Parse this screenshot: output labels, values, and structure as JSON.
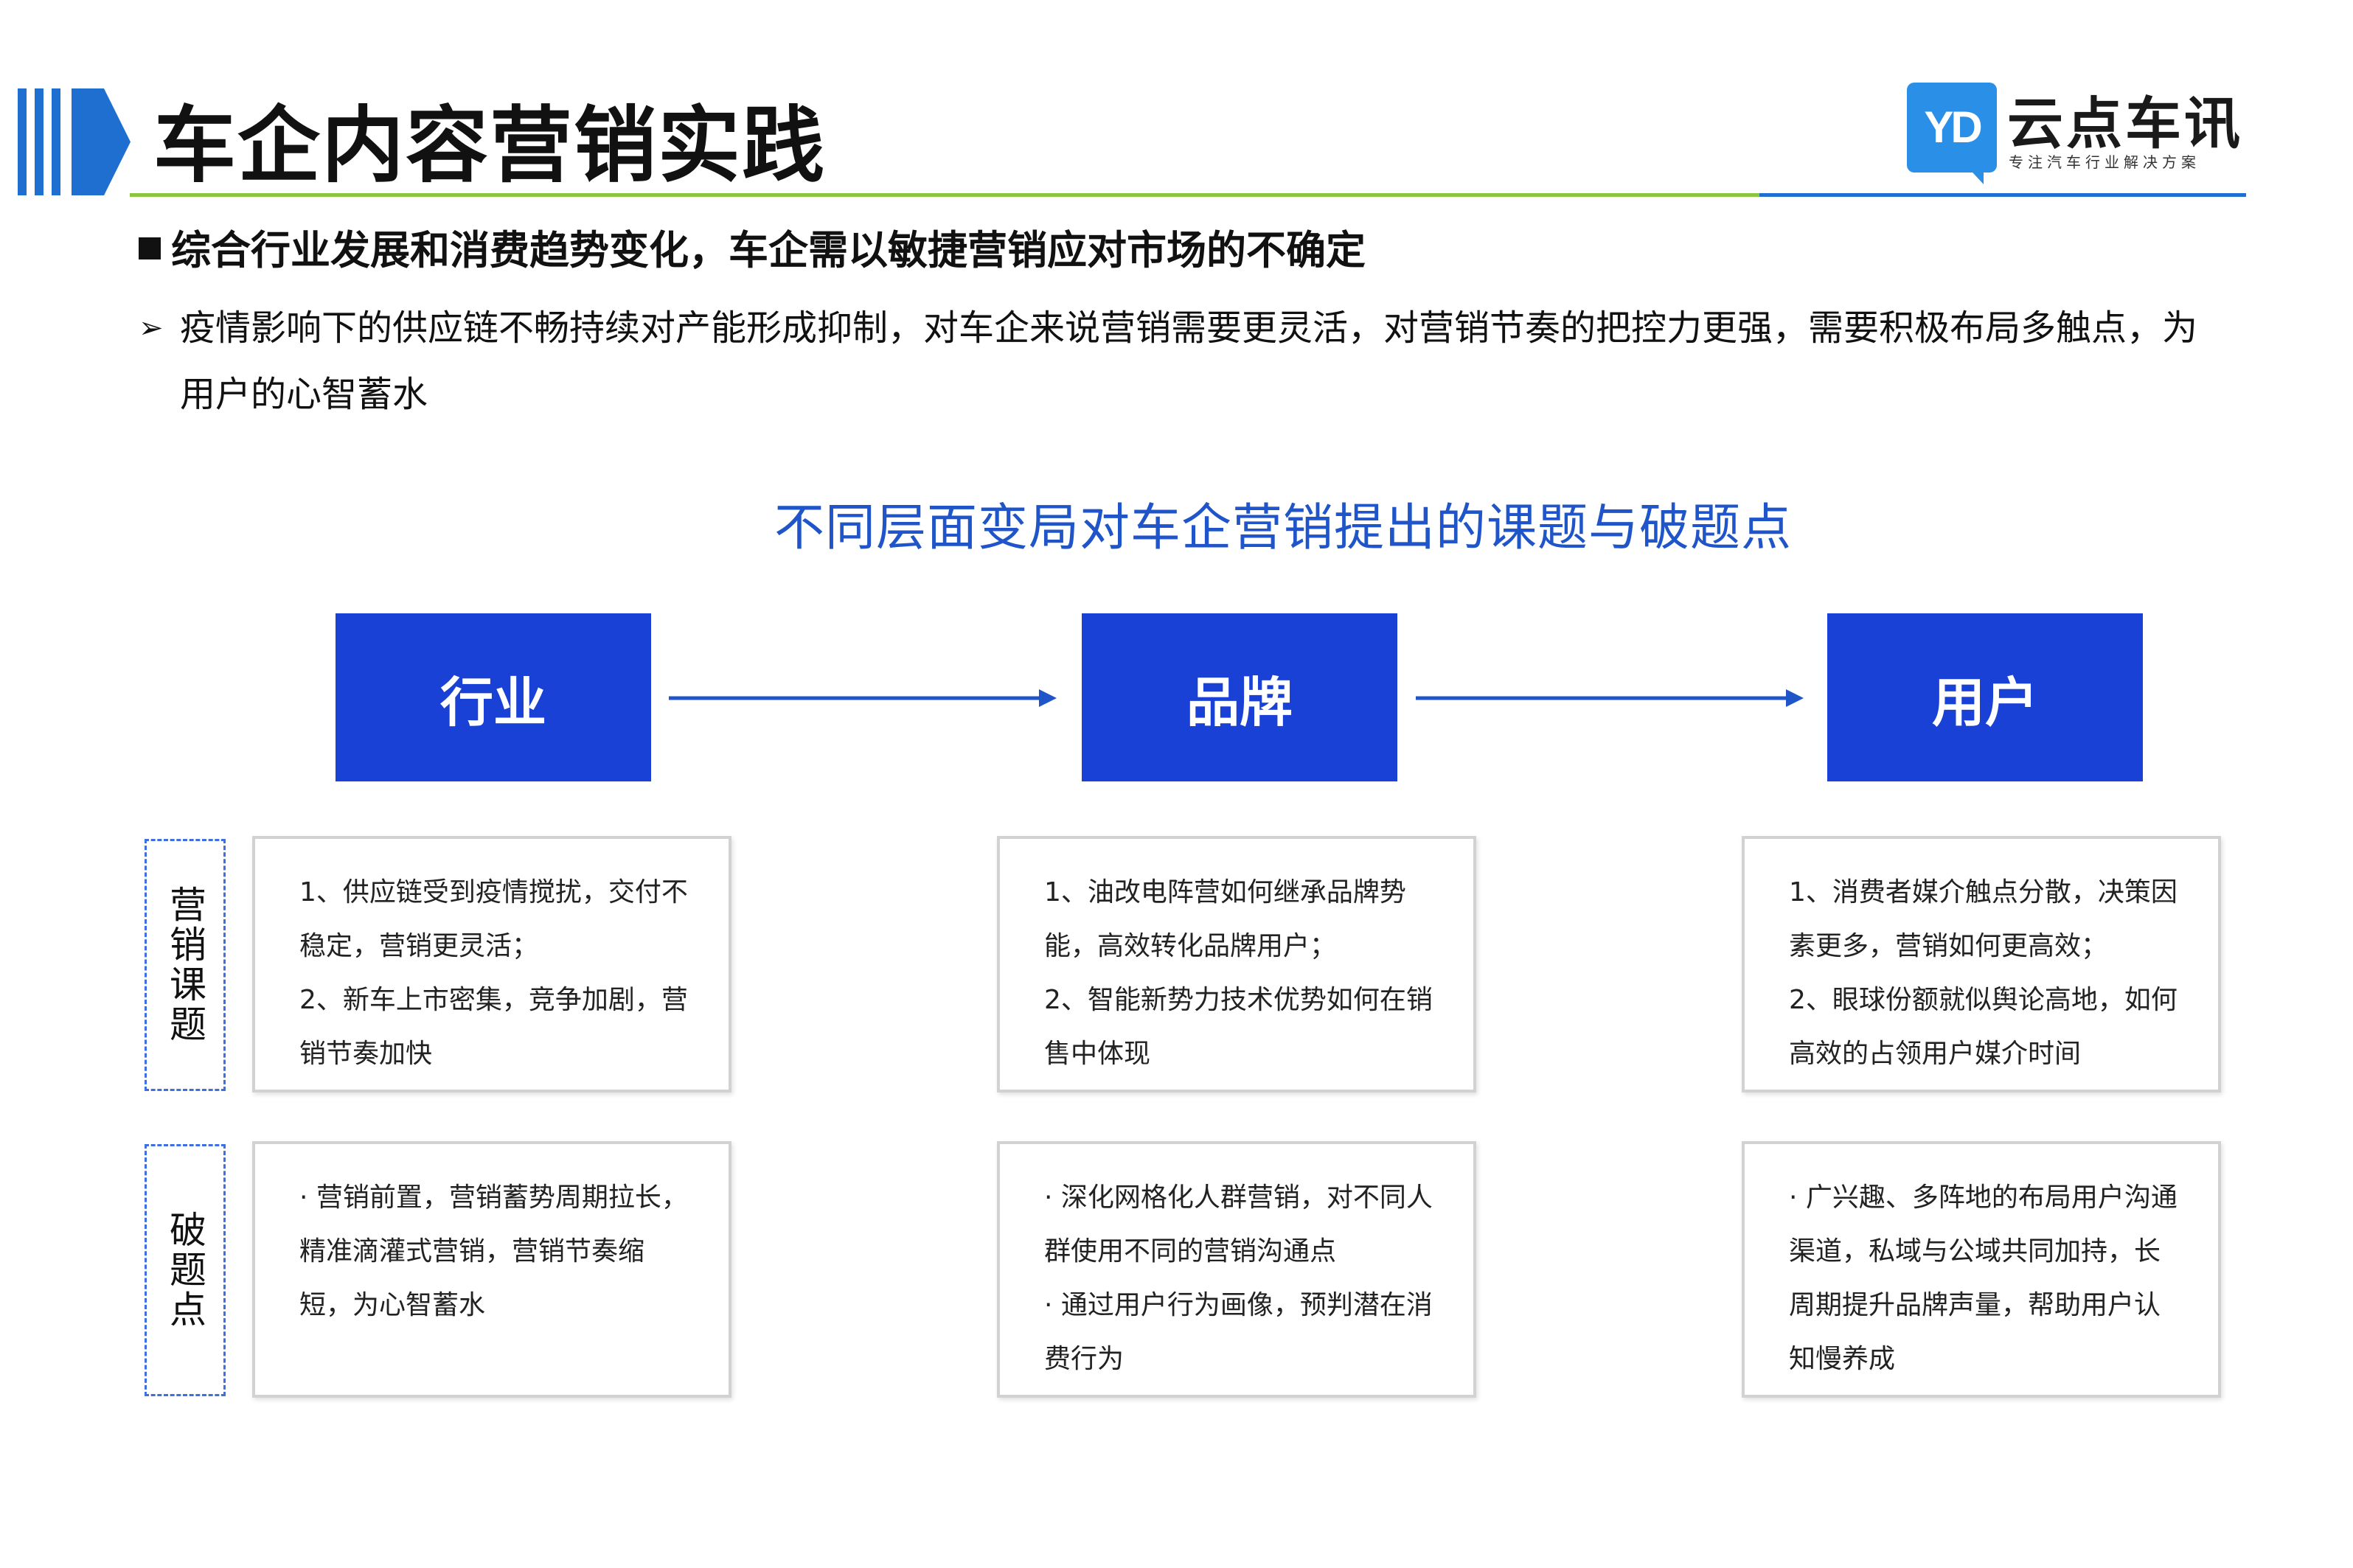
{
  "header": {
    "title": "车企内容营销实践"
  },
  "logo": {
    "mark_text": "YD",
    "name": "云点车讯",
    "slogan": "专注汽车行业解决方案"
  },
  "subhead": "综合行业发展和消费趋势变化，车企需以敏捷营销应对市场的不确定",
  "bullet": {
    "marker": "➢",
    "text": "疫情影响下的供应链不畅持续对产能形成抑制，对车企来说营销需要更灵活，对营销节奏的把控力更强，需要积极布局多触点，为用户的心智蓄水"
  },
  "diagram": {
    "title": "不同层面变局对车企营销提出的课题与破题点",
    "stages": [
      "行业",
      "品牌",
      "用户"
    ],
    "row_labels": {
      "topics": "营销课题",
      "solutions": "破题点"
    },
    "topics": [
      [
        "1、供应链受到疫情搅扰，交付不稳定，营销更灵活；",
        "2、新车上市密集，竞争加剧，营销节奏加快"
      ],
      [
        "1、油改电阵营如何继承品牌势能，高效转化品牌用户；",
        "2、智能新势力技术优势如何在销售中体现"
      ],
      [
        "1、消费者媒介触点分散，决策因素更多，营销如何更高效；",
        "2、眼球份额就似舆论高地，如何高效的占领用户媒介时间"
      ]
    ],
    "solutions": [
      [
        "· 营销前置，营销蓄势周期拉长，精准滴灌式营销，营销节奏缩短，为心智蓄水"
      ],
      [
        "· 深化网格化人群营销，对不同人群使用不同的营销沟通点",
        "· 通过用户行为画像，预判潜在消费行为"
      ],
      [
        "· 广兴趣、多阵地的布局用户沟通渠道，私域与公域共同加持，长周期提升品牌声量，帮助用户认知慢养成"
      ]
    ]
  },
  "colors": {
    "accent_blue": "#1a41d6",
    "header_blue": "#1f6fd1",
    "rule_green": "#8cc63f",
    "diagram_title": "#1f55c9"
  }
}
